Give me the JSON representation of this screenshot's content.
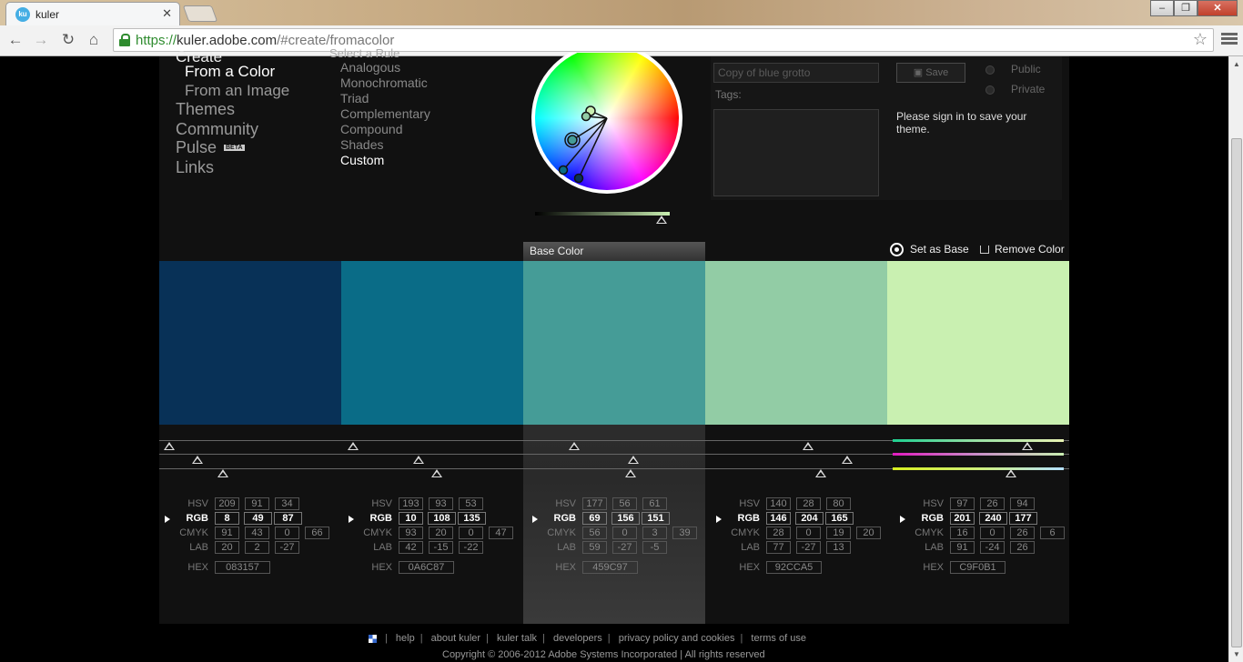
{
  "browser": {
    "tab_title": "kuler",
    "tab_favicon": "ku",
    "url_protocol": "https://",
    "url_host": "kuler.adobe.com",
    "url_path": "/#create/fromacolor"
  },
  "nav": {
    "header": "Create",
    "items": [
      "From a Color",
      "From an Image",
      "Themes",
      "Community",
      "Pulse",
      "Links"
    ],
    "pulse_badge": "BETA"
  },
  "rules": {
    "header": "Select a Rule",
    "items": [
      "Analogous",
      "Monochromatic",
      "Triad",
      "Complementary",
      "Compound",
      "Shades",
      "Custom"
    ],
    "active": "Custom"
  },
  "save": {
    "name_placeholder": "Copy of blue grotto",
    "tags_label": "Tags:",
    "save_label": "Save",
    "public_label": "Public",
    "private_label": "Private",
    "signin_message": "Please sign in to save your theme."
  },
  "base_color_label": "Base Color",
  "set_as_base_label": "Set as Base",
  "remove_color_label": "Remove Color",
  "labels": {
    "hsv": "HSV",
    "rgb": "RGB",
    "cmyk": "CMYK",
    "lab": "LAB",
    "hex": "HEX"
  },
  "swatches": [
    {
      "color": "#083157",
      "hsv": [
        "209",
        "91",
        "34"
      ],
      "rgb": [
        "8",
        "49",
        "87"
      ],
      "cmyk": [
        "91",
        "43",
        "0",
        "66"
      ],
      "lab": [
        "20",
        "2",
        "-27"
      ],
      "hex": "083157"
    },
    {
      "color": "#0A6C87",
      "hsv": [
        "193",
        "93",
        "53"
      ],
      "rgb": [
        "10",
        "108",
        "135"
      ],
      "cmyk": [
        "93",
        "20",
        "0",
        "47"
      ],
      "lab": [
        "42",
        "-15",
        "-22"
      ],
      "hex": "0A6C87"
    },
    {
      "color": "#459C97",
      "hsv": [
        "177",
        "56",
        "61"
      ],
      "rgb": [
        "69",
        "156",
        "151"
      ],
      "cmyk": [
        "56",
        "0",
        "3",
        "39"
      ],
      "lab": [
        "59",
        "-27",
        "-5"
      ],
      "hex": "459C97"
    },
    {
      "color": "#92CCA5",
      "hsv": [
        "140",
        "28",
        "80"
      ],
      "rgb": [
        "146",
        "204",
        "165"
      ],
      "cmyk": [
        "28",
        "0",
        "19",
        "20"
      ],
      "lab": [
        "77",
        "-27",
        "13"
      ],
      "hex": "92CCA5"
    },
    {
      "color": "#C9F0B1",
      "hsv": [
        "97",
        "26",
        "94"
      ],
      "rgb": [
        "201",
        "240",
        "177"
      ],
      "cmyk": [
        "16",
        "0",
        "26",
        "6"
      ],
      "lab": [
        "91",
        "-24",
        "26"
      ],
      "hex": "C9F0B1"
    }
  ],
  "footer": {
    "links": [
      "help",
      "about kuler",
      "kuler talk",
      "developers",
      "privacy policy and cookies",
      "terms of use"
    ],
    "copyright": "Copyright © 2006-2012 Adobe Systems Incorporated | All rights reserved"
  }
}
